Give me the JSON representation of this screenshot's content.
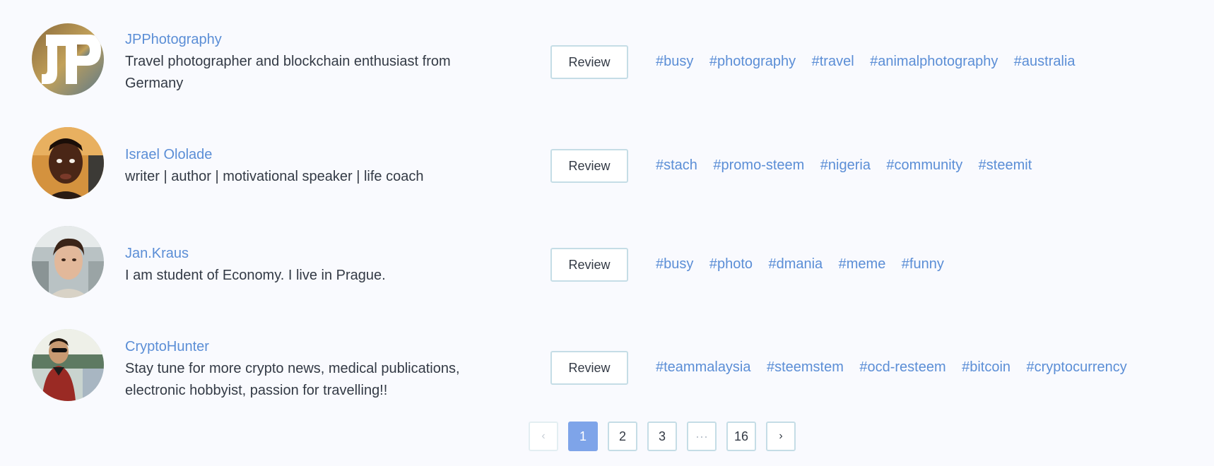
{
  "users": [
    {
      "name": "JPPhotography",
      "bio_lines": [
        "Travel photographer and blockchain enthusiast from",
        "Germany"
      ],
      "review_label": "Review",
      "tags": [
        "#busy",
        "#photography",
        "#travel",
        "#animalphotography",
        "#australia"
      ]
    },
    {
      "name": "Israel Ololade",
      "bio_lines": [
        "writer | author | motivational speaker | life coach"
      ],
      "review_label": "Review",
      "tags": [
        "#stach",
        "#promo-steem",
        "#nigeria",
        "#community",
        "#steemit"
      ]
    },
    {
      "name": "Jan.Kraus",
      "bio_lines": [
        "I am student of Economy. I live in Prague."
      ],
      "review_label": "Review",
      "tags": [
        "#busy",
        "#photo",
        "#dmania",
        "#meme",
        "#funny"
      ]
    },
    {
      "name": "CryptoHunter",
      "bio_lines": [
        "Stay tune for more crypto news, medical publications,",
        "electronic hobbyist, passion for travelling!!"
      ],
      "review_label": "Review",
      "tags": [
        "#teammalaysia",
        "#steemstem",
        "#ocd-resteem",
        "#bitcoin",
        "#cryptocurrency"
      ]
    }
  ],
  "pagination": {
    "prev_icon": "‹",
    "pages": [
      "1",
      "2",
      "3",
      "···",
      "16"
    ],
    "current_page": "1",
    "next_icon": "›"
  },
  "colors": {
    "link": "#5b8ed6",
    "text": "#333a45",
    "active_page": "#7ea4e9",
    "border": "#c5dde6",
    "background": "#f9fafe"
  }
}
